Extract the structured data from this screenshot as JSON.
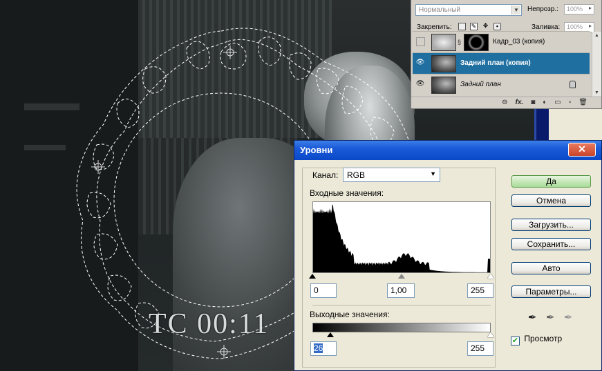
{
  "canvas": {
    "timecode": "TC 00:11"
  },
  "layers_panel": {
    "blend_mode": "Нормальный",
    "opacity_label": "Непрозр.:",
    "opacity_value": "100%",
    "lock_label": "Закрепить:",
    "fill_label": "Заливка:",
    "fill_value": "100%",
    "layers": [
      {
        "name": "Кадр_03 (копия)",
        "visible": false,
        "active": false,
        "has_mask": true
      },
      {
        "name": "Задний план (копия)",
        "visible": true,
        "active": true,
        "has_mask": false
      },
      {
        "name": "Задний план",
        "visible": true,
        "active": false,
        "locked": true
      }
    ],
    "footer_icons": [
      "link-icon",
      "fx-icon",
      "mask-icon",
      "adjustment-icon",
      "folder-icon",
      "new-layer-icon",
      "trash-icon"
    ],
    "fx_label": "fx."
  },
  "levels_dialog": {
    "title": "Уровни",
    "close_glyph": "✕",
    "channel_label": "Канал:",
    "channel_value": "RGB",
    "input_label": "Входные значения:",
    "input_black": "0",
    "input_gamma": "1,00",
    "input_white": "255",
    "output_label": "Выходные значения:",
    "output_black": "26",
    "output_white": "255",
    "buttons": {
      "ok": "Да",
      "cancel": "Отмена",
      "load": "Загрузить...",
      "save": "Сохранить...",
      "auto": "Авто",
      "options": "Параметры..."
    },
    "preview_label": "Просмотр",
    "preview_checked": true
  }
}
